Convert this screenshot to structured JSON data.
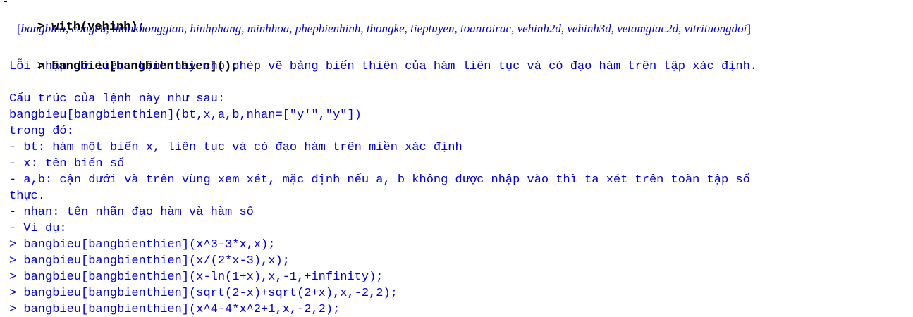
{
  "blocks": [
    {
      "prompt": ">",
      "command": "with(vehinh);",
      "output": [
        "bangbieu",
        "congcu",
        "hinhkhonggian",
        "hinhphang",
        "minhhoa",
        "phepbienhinh",
        "thongke",
        "tieptuyen",
        "toanroirac",
        "vehinh2d",
        "vehinh3d",
        "vetamgiac2d",
        "vitrituongdoi"
      ]
    },
    {
      "prompt": ">",
      "command": "bangbieu[bangbienthien]();",
      "lines": [
        "Lỗi nhập dữ liệu. Lệnh này cho phép vẽ bảng biến thiên của hàm liên tục và có đạo hàm trên tập xác định.",
        "",
        "Cấu trúc của lệnh này như sau:",
        "bangbieu[bangbienthien](bt,x,a,b,nhan=[\"y'\",\"y\"])",
        "trong đó:",
        "- bt: hàm một biến x, liên tục và có đạo hàm trên miền xác định",
        "- x: tên biến số",
        "- a,b: cận dưới và trên vùng xem xét, mặc định nếu a, b không được nhập vào thì ta xét trên toàn tập số",
        "thực.",
        "- nhan: tên nhãn đạo hàm và hàm số",
        "- Ví dụ:",
        "> bangbieu[bangbienthien](x^3-3*x,x);",
        "> bangbieu[bangbienthien](x/(2*x-3),x);",
        "> bangbieu[bangbienthien](x-ln(1+x),x,-1,+infinity);",
        "> bangbieu[bangbienthien](sqrt(2-x)+sqrt(2+x),x,-2,2);",
        "> bangbieu[bangbienthien](x^4-4*x^2+1,x,-2,2);"
      ]
    }
  ],
  "colors": {
    "command": "#000000",
    "output": "#0000cc",
    "background": "#ffffff"
  }
}
